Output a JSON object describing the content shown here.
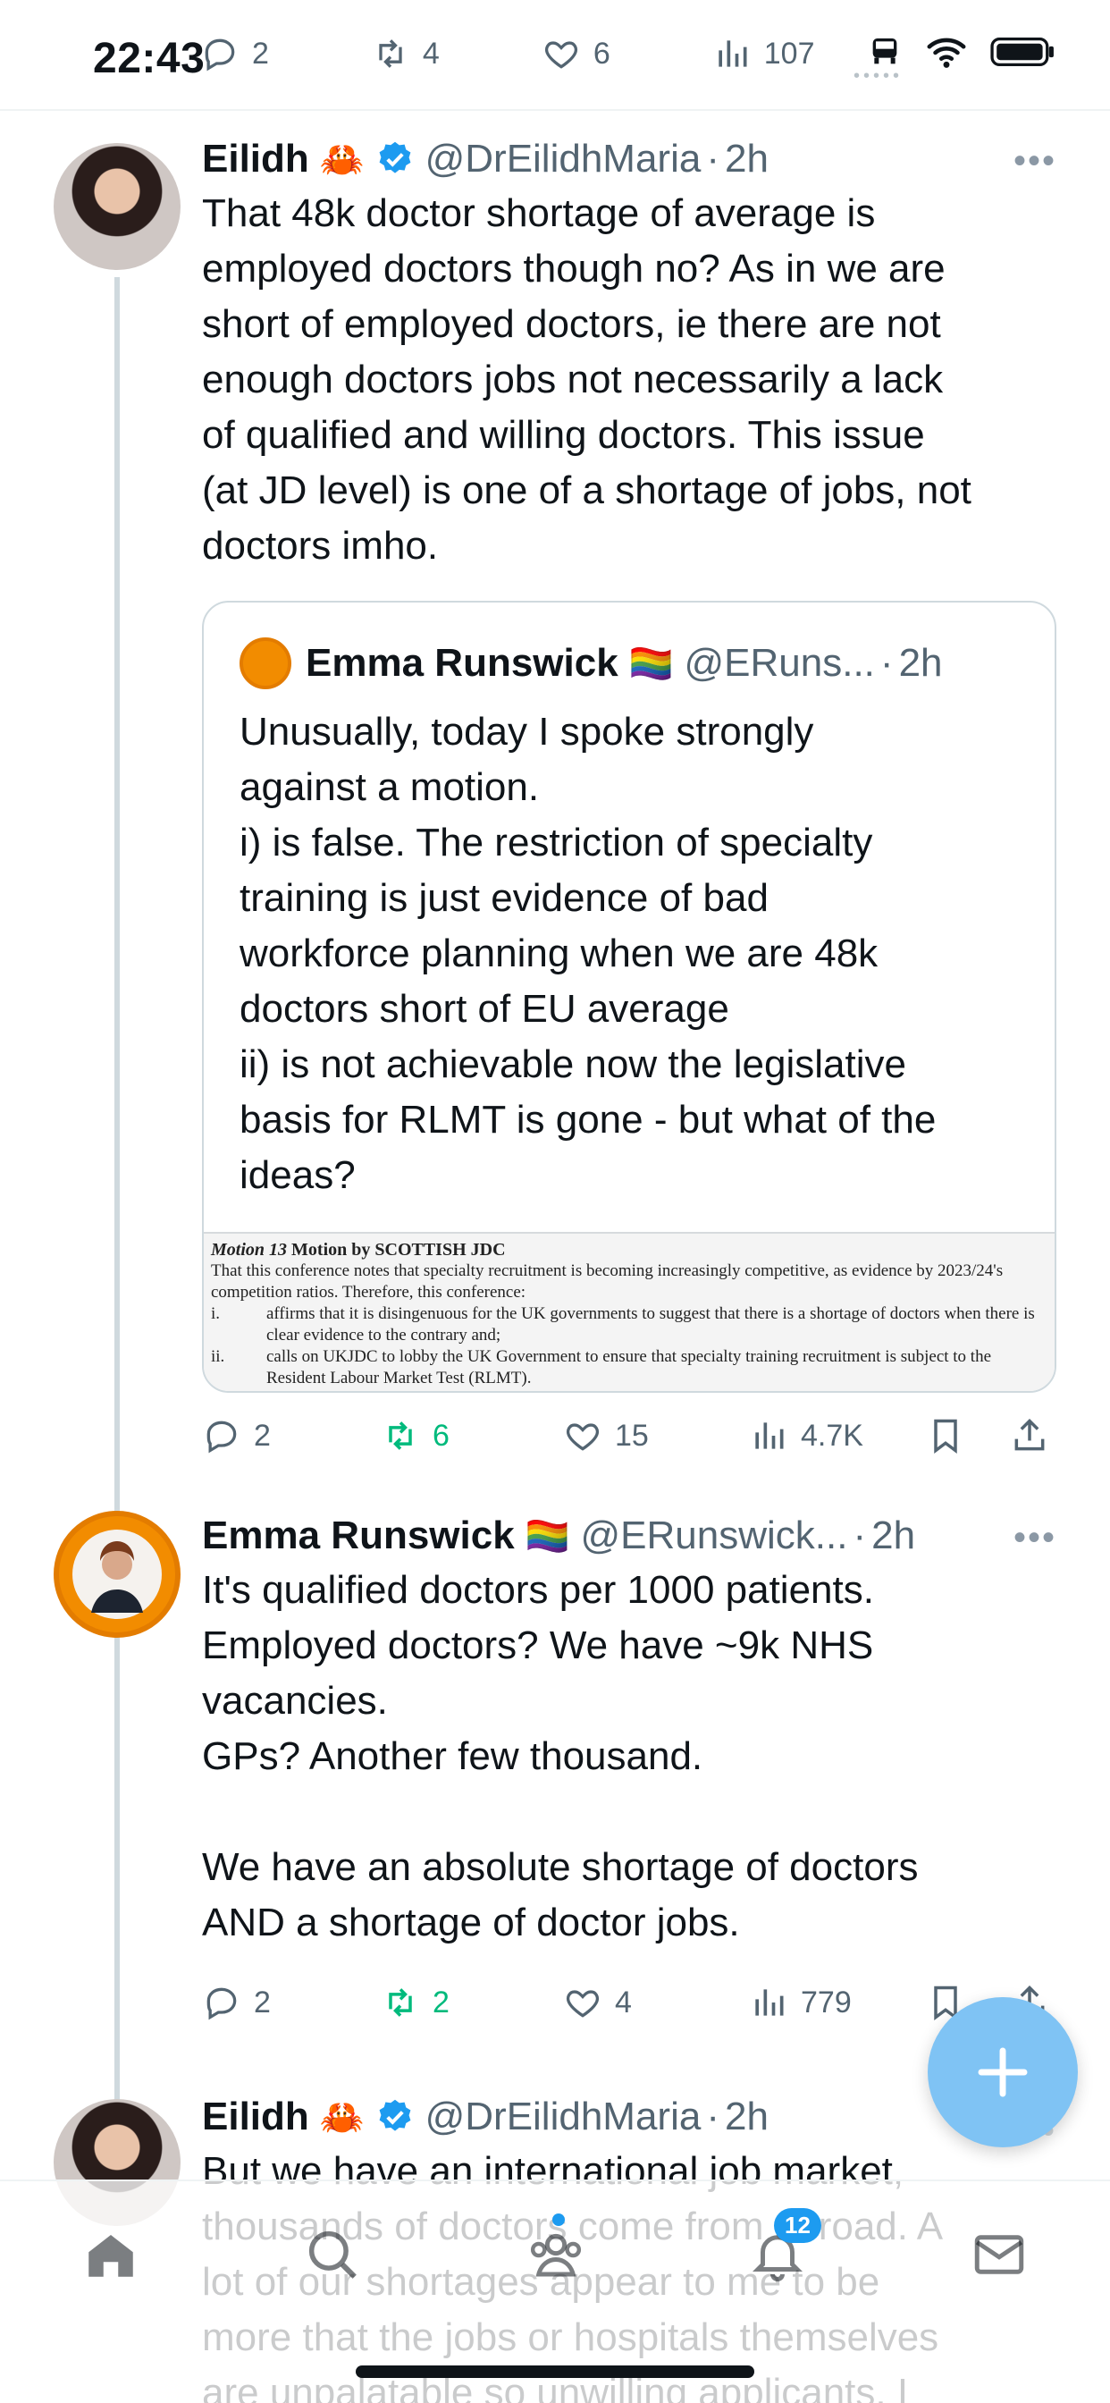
{
  "status_bar": {
    "time": "22:43",
    "top_actions": {
      "replies": "2",
      "reposts": "4",
      "likes": "6",
      "views": "107"
    }
  },
  "tweets": [
    {
      "name": "Eilidh",
      "emoji": "🦀",
      "verified": true,
      "handle": "@DrEilidhMaria",
      "time": "2h",
      "text": "That 48k doctor shortage of average is\nemployed doctors though no? As in we are\nshort of employed doctors, ie there are not\nenough doctors jobs not necessarily a lack\nof qualified and willing doctors. This issue\n(at JD level) is one of a shortage of jobs, not\ndoctors imho.",
      "quote": {
        "name": "Emma Runswick",
        "emoji": "🏳️‍🌈",
        "handle": "@ERuns...",
        "time": "2h",
        "text": "Unusually, today I spoke strongly\nagainst a motion.\ni) is false. The restriction of specialty\ntraining is just evidence of bad\nworkforce planning when we are 48k\ndoctors short of EU average\nii) is not achievable now the legislative\nbasis for RLMT is gone - but what of the\nideas?",
        "image": {
          "motion_label": "Motion 13",
          "motion_by": "Motion by SCOTTISH JDC",
          "intro": "That this conference notes that specialty recruitment is becoming increasingly competitive, as evidence by 2023/24's competition ratios. Therefore, this conference:",
          "items": [
            {
              "num": "i.",
              "text": "affirms that it is disingenuous for the UK governments to suggest that there is a shortage of doctors when there is clear evidence to the contrary and;"
            },
            {
              "num": "ii.",
              "text": "calls on UKJDC to lobby the UK Government to ensure that specialty training recruitment is subject to the Resident Labour Market Test (RLMT)."
            }
          ]
        }
      },
      "stats": {
        "replies": "2",
        "reposts": "6",
        "likes": "15",
        "views": "4.7K"
      }
    },
    {
      "name": "Emma Runswick",
      "emoji": "🏳️‍🌈",
      "verified": false,
      "handle": "@ERunswick...",
      "time": "2h",
      "text": "It's qualified doctors per 1000 patients.\nEmployed doctors? We have ~9k NHS\nvacancies.\nGPs? Another few thousand.\n\nWe have an absolute shortage of doctors\nAND a shortage of doctor jobs.",
      "stats": {
        "replies": "2",
        "reposts": "2",
        "likes": "4",
        "views": "779"
      }
    },
    {
      "name": "Eilidh",
      "emoji": "🦀",
      "verified": true,
      "handle": "@DrEilidhMaria",
      "time": "2h",
      "text": "But we have an international job market,\nthousands of doctors come from abroad. A\nlot of our shortages appear to me to be\nmore that the jobs or hospitals themselves\nare unpalatable so unwilling applicants. I"
    }
  ],
  "bottom_nav": {
    "notifications_badge": "12"
  },
  "colors": {
    "accent": "#1d9bf0",
    "repost_green": "#00ba7c",
    "muted_text": "#536471",
    "fab": "#7fc3f4"
  }
}
